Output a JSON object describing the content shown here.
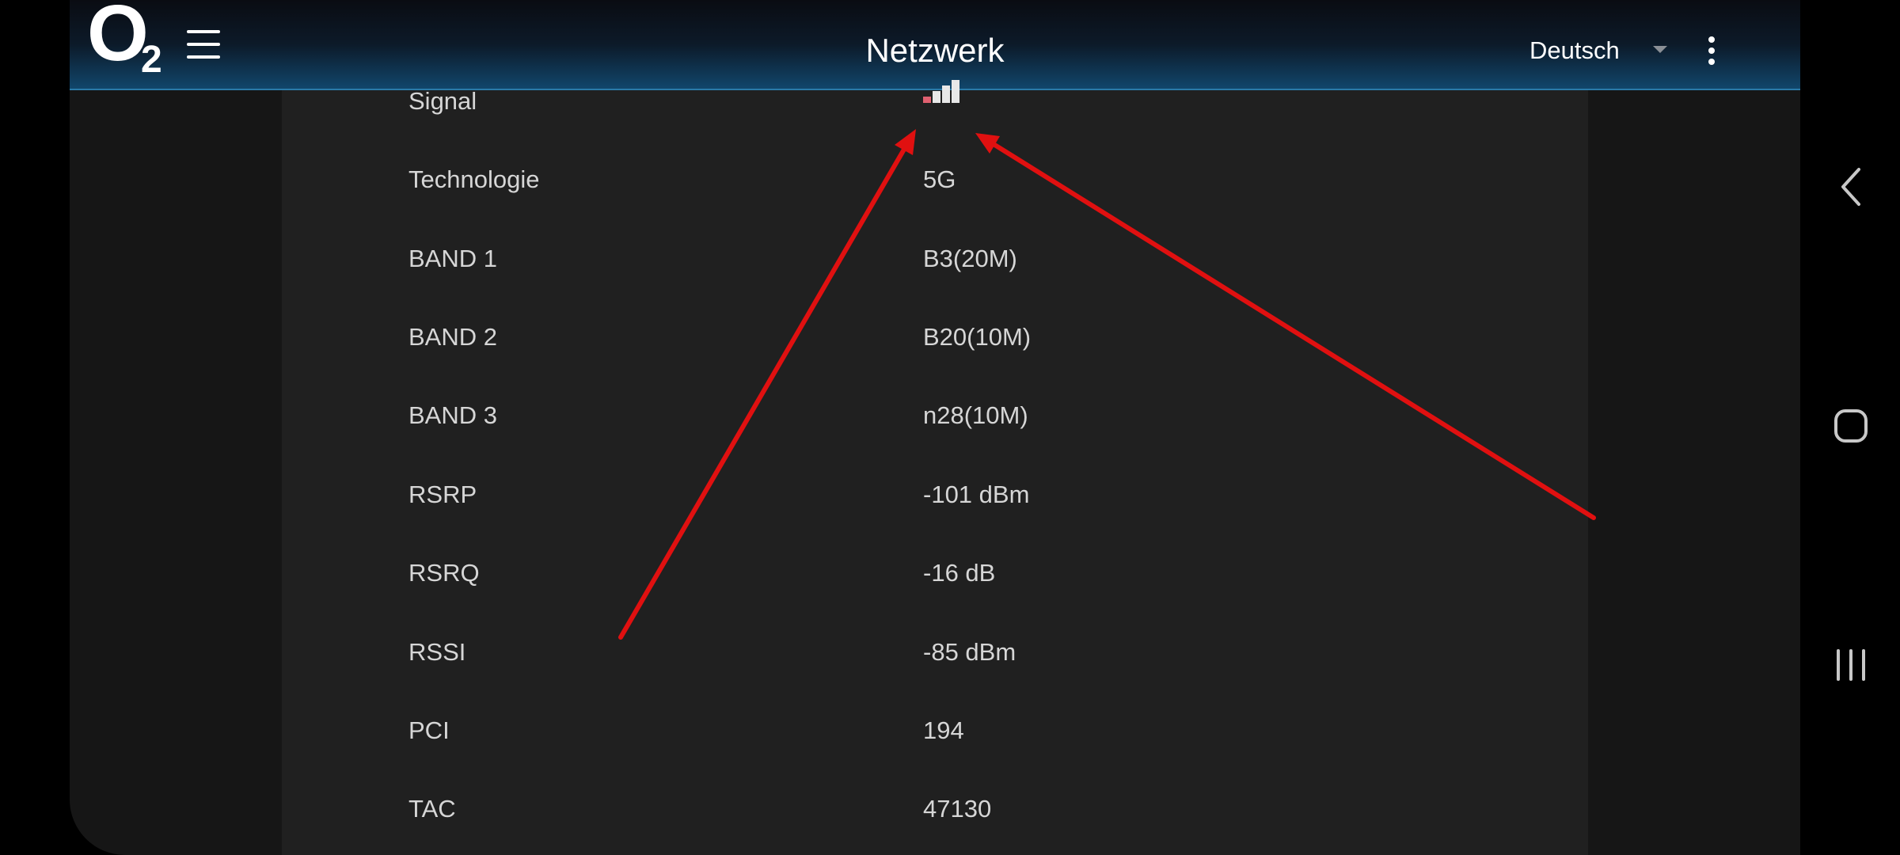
{
  "header": {
    "logo_letter": "O",
    "logo_subscript": "2",
    "title": "Netzwerk",
    "language": "Deutsch"
  },
  "rows": [
    {
      "label": "Signal",
      "value": "",
      "signal_level": 0.25
    },
    {
      "label": "Technologie",
      "value": "5G"
    },
    {
      "label": "BAND 1",
      "value": "B3(20M)"
    },
    {
      "label": "BAND 2",
      "value": "B20(10M)"
    },
    {
      "label": "BAND 3",
      "value": "n28(10M)"
    },
    {
      "label": "RSRP",
      "value": "-101 dBm"
    },
    {
      "label": "RSRQ",
      "value": "-16 dB"
    },
    {
      "label": "RSSI",
      "value": "-85 dBm"
    },
    {
      "label": "PCI",
      "value": "194"
    },
    {
      "label": "TAC",
      "value": "47130"
    }
  ],
  "colors": {
    "annotation_arrow": "#e01010",
    "signal_active": "#e06070",
    "signal_inactive": "#e8e8e8"
  },
  "icons": {
    "menu": "hamburger-icon",
    "more": "more-vert-icon",
    "signal": "signal-bars-icon",
    "back": "back-icon",
    "home": "home-icon",
    "recents": "recents-icon"
  }
}
